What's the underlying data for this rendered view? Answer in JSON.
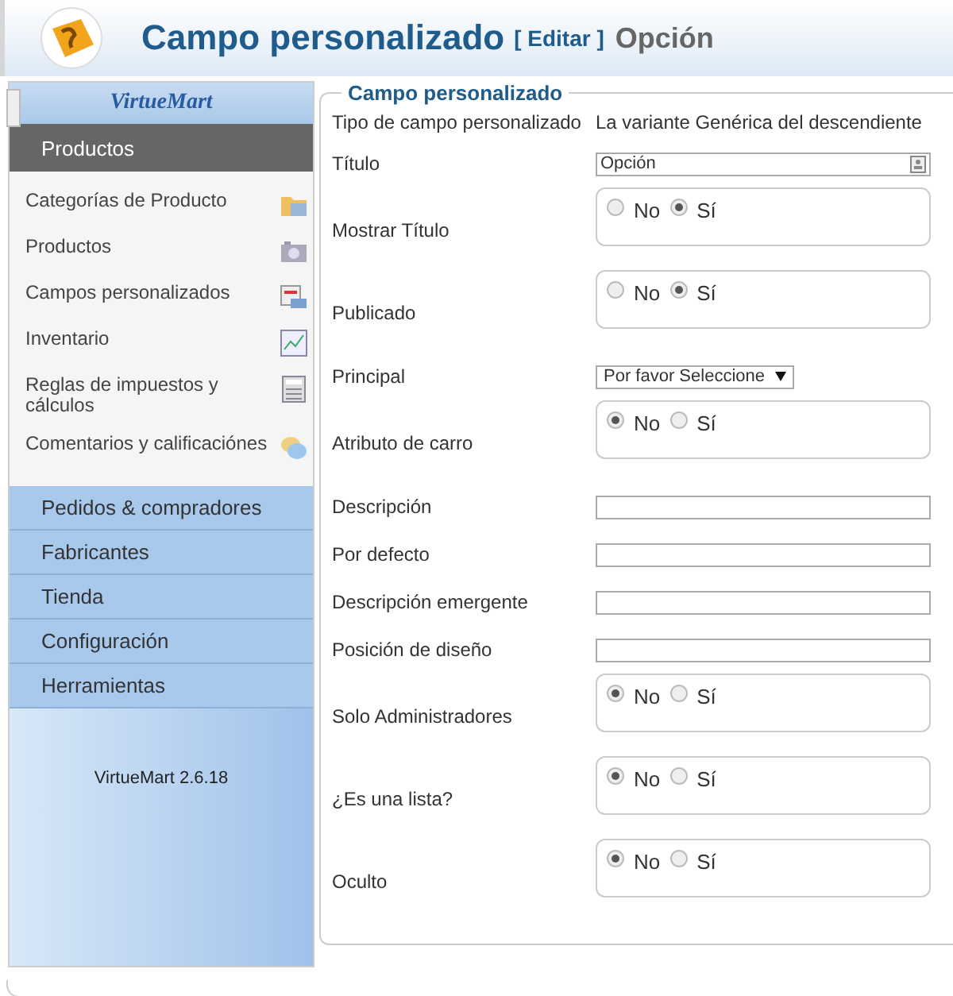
{
  "header": {
    "title": "Campo personalizado",
    "action": "[ Editar ]",
    "subtitle": "Opción"
  },
  "sidebar": {
    "logo": "VirtueMart",
    "active_section": "Productos",
    "items": [
      {
        "label": "Categorías de Producto",
        "kind": "folder"
      },
      {
        "label": "Productos",
        "kind": "camera"
      },
      {
        "label": "Campos personalizados",
        "kind": "form"
      },
      {
        "label": "Inventario",
        "kind": "chart"
      },
      {
        "label": "Reglas de impuestos y cálculos",
        "kind": "calculator"
      },
      {
        "label": "Comentarios y calificaciónes",
        "kind": "speech"
      }
    ],
    "sections": [
      "Pedidos & compradores",
      "Fabricantes",
      "Tienda",
      "Configuración",
      "Herramientas"
    ],
    "version": "VirtueMart 2.6.18"
  },
  "form": {
    "legend": "Campo personalizado",
    "rows": [
      {
        "kind": "info",
        "label": "Tipo de campo personalizado",
        "value": "La variante Genérica del descendiente"
      },
      {
        "kind": "text",
        "label": "Título",
        "value": "Opción"
      },
      {
        "kind": "radio",
        "label": "Mostrar Título",
        "options": [
          {
            "label": "No",
            "selected": false
          },
          {
            "label": "Sí",
            "selected": true
          }
        ]
      },
      {
        "kind": "radio",
        "label": "Publicado",
        "options": [
          {
            "label": "No",
            "selected": false
          },
          {
            "label": "Sí",
            "selected": true
          }
        ]
      },
      {
        "kind": "select",
        "label": "Principal",
        "value": "Por favor Seleccione"
      },
      {
        "kind": "radio",
        "label": "Atributo de carro",
        "options": [
          {
            "label": "No",
            "selected": true
          },
          {
            "label": "Sí",
            "selected": false
          }
        ]
      },
      {
        "kind": "text",
        "label": "Descripción"
      },
      {
        "kind": "text",
        "label": "Por defecto"
      },
      {
        "kind": "text",
        "label": "Descripción emergente"
      },
      {
        "kind": "text",
        "label": "Posición de diseño"
      },
      {
        "kind": "radio",
        "label": "Solo Administradores",
        "options": [
          {
            "label": "No",
            "selected": true
          },
          {
            "label": "Sí",
            "selected": false
          }
        ]
      },
      {
        "kind": "radio",
        "label": "¿Es una lista?",
        "options": [
          {
            "label": "No",
            "selected": true
          },
          {
            "label": "Sí",
            "selected": false
          }
        ]
      },
      {
        "kind": "radio",
        "label": "Oculto",
        "options": [
          {
            "label": "No",
            "selected": true
          },
          {
            "label": "Sí",
            "selected": false
          }
        ]
      }
    ]
  }
}
